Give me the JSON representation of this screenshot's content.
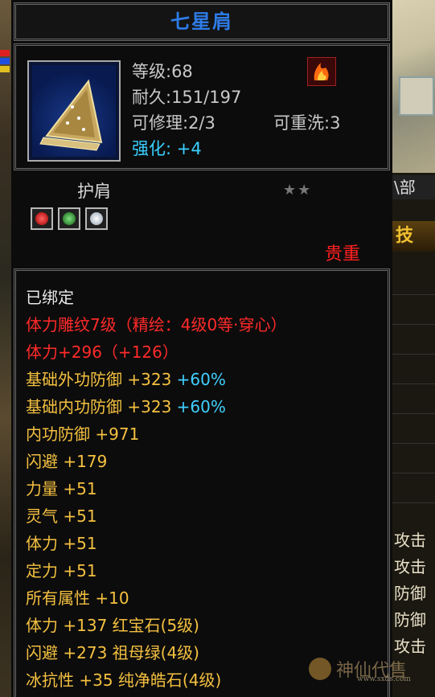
{
  "item": {
    "name": "七星肩",
    "level": "等级:68",
    "durability": "耐久:151/197",
    "repair": "可修理:2/3",
    "reroll": "可重洗:3",
    "enhance_label": "强化:",
    "enhance_value": "+4",
    "type": "护肩",
    "stars": "★★",
    "rarity": "贵重",
    "gems": [
      "red-gem-icon",
      "green-gem-icon",
      "white-gem-icon"
    ]
  },
  "attributes": [
    {
      "segments": [
        {
          "text": "已绑定",
          "color": "white"
        }
      ]
    },
    {
      "segments": [
        {
          "text": "体力雕纹7级（精绘：4级0等·穿心）",
          "color": "red"
        }
      ]
    },
    {
      "segments": [
        {
          "text": "体力+296（+126）",
          "color": "red"
        }
      ]
    },
    {
      "segments": [
        {
          "text": "基础外功防御 +323 ",
          "color": "gold"
        },
        {
          "text": "+60%",
          "color": "cyan"
        }
      ]
    },
    {
      "segments": [
        {
          "text": "基础内功防御 +323 ",
          "color": "gold"
        },
        {
          "text": "+60%",
          "color": "cyan"
        }
      ]
    },
    {
      "segments": [
        {
          "text": "内功防御 +971",
          "color": "gold"
        }
      ]
    },
    {
      "segments": [
        {
          "text": "闪避 +179",
          "color": "gold"
        }
      ]
    },
    {
      "segments": [
        {
          "text": "力量 +51",
          "color": "gold"
        }
      ]
    },
    {
      "segments": [
        {
          "text": "灵气 +51",
          "color": "gold"
        }
      ]
    },
    {
      "segments": [
        {
          "text": "体力 +51",
          "color": "gold"
        }
      ]
    },
    {
      "segments": [
        {
          "text": "定力 +51",
          "color": "gold"
        }
      ]
    },
    {
      "segments": [
        {
          "text": "所有属性 +10",
          "color": "gold"
        }
      ]
    },
    {
      "segments": [
        {
          "text": "体力 +137 红宝石(5级)",
          "color": "gold"
        }
      ]
    },
    {
      "segments": [
        {
          "text": "闪避 +273 祖母绿(4级)",
          "color": "gold"
        }
      ]
    },
    {
      "segments": [
        {
          "text": "冰抗性 +35 纯净皓石(4级)",
          "color": "gold"
        }
      ]
    }
  ],
  "background": {
    "right_tab": "\\部",
    "right_skill": "技",
    "right_labels": [
      "攻击",
      "攻击",
      "防御",
      "防御",
      "攻击"
    ],
    "watermark": "神仙代售",
    "watermark_url": "www.sxds.com"
  },
  "colors": {
    "title": "#2e7ce8",
    "red": "#ff2a2a",
    "gold": "#f4c040",
    "cyan": "#40d0ff",
    "white": "#e8e8e8"
  }
}
